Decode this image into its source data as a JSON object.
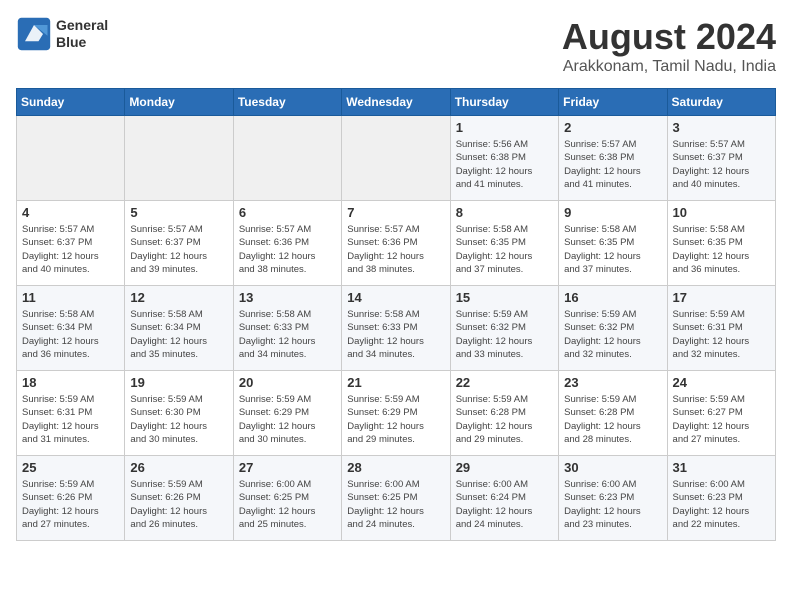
{
  "logo": {
    "line1": "General",
    "line2": "Blue"
  },
  "title": "August 2024",
  "location": "Arakkonam, Tamil Nadu, India",
  "weekdays": [
    "Sunday",
    "Monday",
    "Tuesday",
    "Wednesday",
    "Thursday",
    "Friday",
    "Saturday"
  ],
  "weeks": [
    [
      {
        "day": "",
        "info": ""
      },
      {
        "day": "",
        "info": ""
      },
      {
        "day": "",
        "info": ""
      },
      {
        "day": "",
        "info": ""
      },
      {
        "day": "1",
        "info": "Sunrise: 5:56 AM\nSunset: 6:38 PM\nDaylight: 12 hours\nand 41 minutes."
      },
      {
        "day": "2",
        "info": "Sunrise: 5:57 AM\nSunset: 6:38 PM\nDaylight: 12 hours\nand 41 minutes."
      },
      {
        "day": "3",
        "info": "Sunrise: 5:57 AM\nSunset: 6:37 PM\nDaylight: 12 hours\nand 40 minutes."
      }
    ],
    [
      {
        "day": "4",
        "info": "Sunrise: 5:57 AM\nSunset: 6:37 PM\nDaylight: 12 hours\nand 40 minutes."
      },
      {
        "day": "5",
        "info": "Sunrise: 5:57 AM\nSunset: 6:37 PM\nDaylight: 12 hours\nand 39 minutes."
      },
      {
        "day": "6",
        "info": "Sunrise: 5:57 AM\nSunset: 6:36 PM\nDaylight: 12 hours\nand 38 minutes."
      },
      {
        "day": "7",
        "info": "Sunrise: 5:57 AM\nSunset: 6:36 PM\nDaylight: 12 hours\nand 38 minutes."
      },
      {
        "day": "8",
        "info": "Sunrise: 5:58 AM\nSunset: 6:35 PM\nDaylight: 12 hours\nand 37 minutes."
      },
      {
        "day": "9",
        "info": "Sunrise: 5:58 AM\nSunset: 6:35 PM\nDaylight: 12 hours\nand 37 minutes."
      },
      {
        "day": "10",
        "info": "Sunrise: 5:58 AM\nSunset: 6:35 PM\nDaylight: 12 hours\nand 36 minutes."
      }
    ],
    [
      {
        "day": "11",
        "info": "Sunrise: 5:58 AM\nSunset: 6:34 PM\nDaylight: 12 hours\nand 36 minutes."
      },
      {
        "day": "12",
        "info": "Sunrise: 5:58 AM\nSunset: 6:34 PM\nDaylight: 12 hours\nand 35 minutes."
      },
      {
        "day": "13",
        "info": "Sunrise: 5:58 AM\nSunset: 6:33 PM\nDaylight: 12 hours\nand 34 minutes."
      },
      {
        "day": "14",
        "info": "Sunrise: 5:58 AM\nSunset: 6:33 PM\nDaylight: 12 hours\nand 34 minutes."
      },
      {
        "day": "15",
        "info": "Sunrise: 5:59 AM\nSunset: 6:32 PM\nDaylight: 12 hours\nand 33 minutes."
      },
      {
        "day": "16",
        "info": "Sunrise: 5:59 AM\nSunset: 6:32 PM\nDaylight: 12 hours\nand 32 minutes."
      },
      {
        "day": "17",
        "info": "Sunrise: 5:59 AM\nSunset: 6:31 PM\nDaylight: 12 hours\nand 32 minutes."
      }
    ],
    [
      {
        "day": "18",
        "info": "Sunrise: 5:59 AM\nSunset: 6:31 PM\nDaylight: 12 hours\nand 31 minutes."
      },
      {
        "day": "19",
        "info": "Sunrise: 5:59 AM\nSunset: 6:30 PM\nDaylight: 12 hours\nand 30 minutes."
      },
      {
        "day": "20",
        "info": "Sunrise: 5:59 AM\nSunset: 6:29 PM\nDaylight: 12 hours\nand 30 minutes."
      },
      {
        "day": "21",
        "info": "Sunrise: 5:59 AM\nSunset: 6:29 PM\nDaylight: 12 hours\nand 29 minutes."
      },
      {
        "day": "22",
        "info": "Sunrise: 5:59 AM\nSunset: 6:28 PM\nDaylight: 12 hours\nand 29 minutes."
      },
      {
        "day": "23",
        "info": "Sunrise: 5:59 AM\nSunset: 6:28 PM\nDaylight: 12 hours\nand 28 minutes."
      },
      {
        "day": "24",
        "info": "Sunrise: 5:59 AM\nSunset: 6:27 PM\nDaylight: 12 hours\nand 27 minutes."
      }
    ],
    [
      {
        "day": "25",
        "info": "Sunrise: 5:59 AM\nSunset: 6:26 PM\nDaylight: 12 hours\nand 27 minutes."
      },
      {
        "day": "26",
        "info": "Sunrise: 5:59 AM\nSunset: 6:26 PM\nDaylight: 12 hours\nand 26 minutes."
      },
      {
        "day": "27",
        "info": "Sunrise: 6:00 AM\nSunset: 6:25 PM\nDaylight: 12 hours\nand 25 minutes."
      },
      {
        "day": "28",
        "info": "Sunrise: 6:00 AM\nSunset: 6:25 PM\nDaylight: 12 hours\nand 24 minutes."
      },
      {
        "day": "29",
        "info": "Sunrise: 6:00 AM\nSunset: 6:24 PM\nDaylight: 12 hours\nand 24 minutes."
      },
      {
        "day": "30",
        "info": "Sunrise: 6:00 AM\nSunset: 6:23 PM\nDaylight: 12 hours\nand 23 minutes."
      },
      {
        "day": "31",
        "info": "Sunrise: 6:00 AM\nSunset: 6:23 PM\nDaylight: 12 hours\nand 22 minutes."
      }
    ]
  ]
}
